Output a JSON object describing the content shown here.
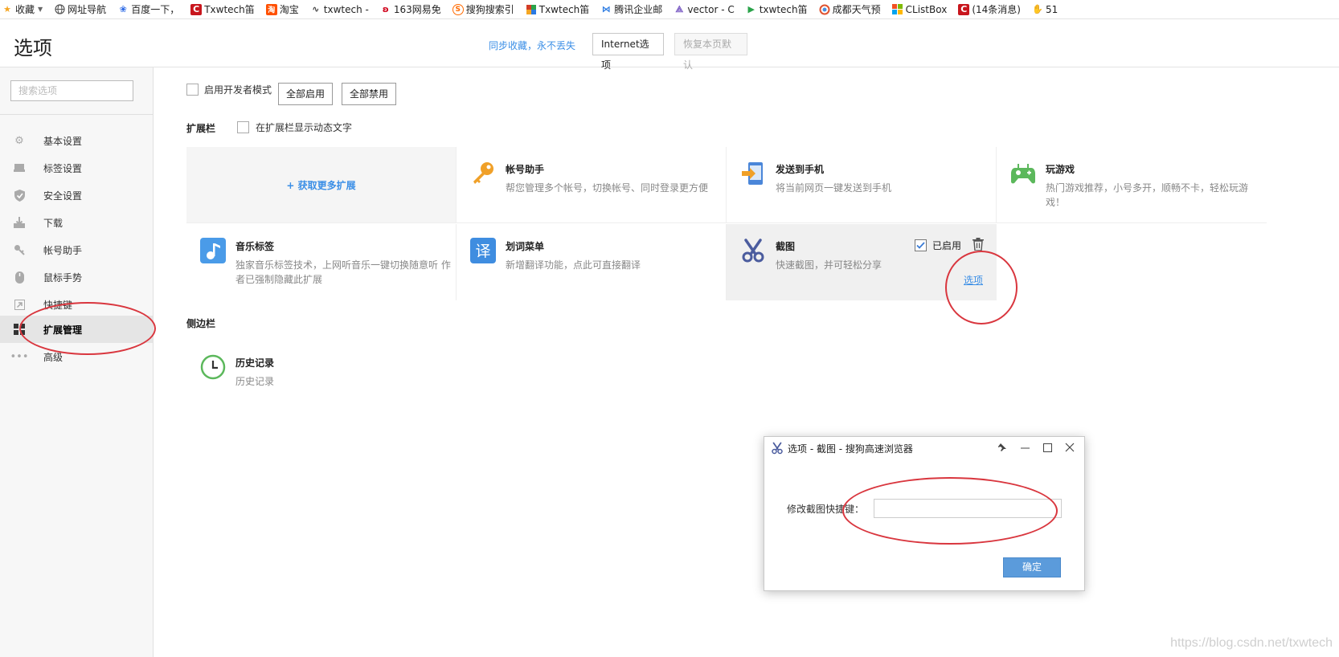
{
  "bookmarks": [
    {
      "label": "收藏",
      "icon": "star-icon",
      "color": "#f5a623"
    },
    {
      "label": "网址导航",
      "icon": "globe-icon",
      "color": "#555555"
    },
    {
      "label": "百度一下，",
      "icon": "paw-icon",
      "color": "#2e6be6"
    },
    {
      "label": "Txwtech笛",
      "icon": "csdn-icon",
      "color": "#c8161d"
    },
    {
      "label": "淘宝",
      "icon": "taobao-icon",
      "color": "#ff5000"
    },
    {
      "label": "txwtech -",
      "icon": "link-icon",
      "color": "#444444"
    },
    {
      "label": "163网易免",
      "icon": "netease-icon",
      "color": "#d0021b"
    },
    {
      "label": "搜狗搜索引",
      "icon": "sogou-icon",
      "color": "#ff6a00"
    },
    {
      "label": "Txwtech笛",
      "icon": "colorful-icon",
      "color": "#d33c26"
    },
    {
      "label": "腾讯企业邮",
      "icon": "tencent-mail-icon",
      "color": "#2a7ae2"
    },
    {
      "label": "vector - C",
      "icon": "vector-icon",
      "color": "#7b5cc4"
    },
    {
      "label": "txwtech笛",
      "icon": "flag-icon",
      "color": "#2aa34a"
    },
    {
      "label": "成都天气预",
      "icon": "weather-icon",
      "color": "#e0522f"
    },
    {
      "label": "CListBox",
      "icon": "windows-icon",
      "color": "#f25022"
    },
    {
      "label": "(14条消息)",
      "icon": "csdn-icon",
      "color": "#c8161d"
    },
    {
      "label": "51",
      "icon": "hand-icon",
      "color": "#2e6be6"
    }
  ],
  "header": {
    "title": "选项",
    "sync_link": "同步收藏，永不丢失",
    "internet_button": "Internet选项",
    "restore_button": "恢复本页默认"
  },
  "sidebar": {
    "search_placeholder": "搜索选项",
    "items": [
      {
        "label": "基本设置",
        "icon": "gear-icon"
      },
      {
        "label": "标签设置",
        "icon": "tab-icon"
      },
      {
        "label": "安全设置",
        "icon": "shield-icon"
      },
      {
        "label": "下载",
        "icon": "download-icon"
      },
      {
        "label": "帐号助手",
        "icon": "key-icon"
      },
      {
        "label": "鼠标手势",
        "icon": "mouse-icon"
      },
      {
        "label": "快捷键",
        "icon": "shortcut-icon"
      },
      {
        "label": "扩展管理",
        "icon": "extensions-icon",
        "active": true
      },
      {
        "label": "高级",
        "icon": "more-icon"
      }
    ]
  },
  "content": {
    "dev_mode_label": "启用开发者模式",
    "enable_all": "全部启用",
    "disable_all": "全部禁用",
    "toolbar_section": "扩展栏",
    "dynamic_text_label": "在扩展栏显示动态文字",
    "get_more": "+ 获取更多扩展",
    "extensions": [
      {
        "name": "帐号助手",
        "desc": "帮您管理多个帐号，切换帐号、同时登录更方便",
        "icon": "key-icon"
      },
      {
        "name": "发送到手机",
        "desc": "将当前网页一键发送到手机",
        "icon": "send-to-phone-icon"
      },
      {
        "name": "玩游戏",
        "desc": "热门游戏推荐，小号多开，顺畅不卡，轻松玩游戏！",
        "icon": "gamepad-icon"
      },
      {
        "name": "音乐标签",
        "desc": "独家音乐标签技术，上网听音乐一键切换随意听 作者已强制隐藏此扩展",
        "icon": "music-icon"
      },
      {
        "name": "划词菜单",
        "desc": "新增翻译功能，点此可直接翻译",
        "icon": "translate-icon"
      },
      {
        "name": "截图",
        "desc": "快速截图，并可轻松分享",
        "icon": "scissors-icon",
        "enabled_label": "已启用",
        "options_link": "选项"
      }
    ],
    "sidebar_section": "侧边栏",
    "sidebar_extensions": [
      {
        "name": "历史记录",
        "desc": "历史记录",
        "icon": "clock-icon"
      }
    ]
  },
  "dialog": {
    "title": "选项 - 截图 - 搜狗高速浏览器",
    "label": "修改截图快捷键：",
    "input_value": "",
    "ok_button": "确定"
  },
  "watermark": "https://blog.csdn.net/txwtech",
  "colors": {
    "accent": "#3a8ee6",
    "annotation": "#d9363e",
    "ok_button": "#5b9bdb"
  }
}
